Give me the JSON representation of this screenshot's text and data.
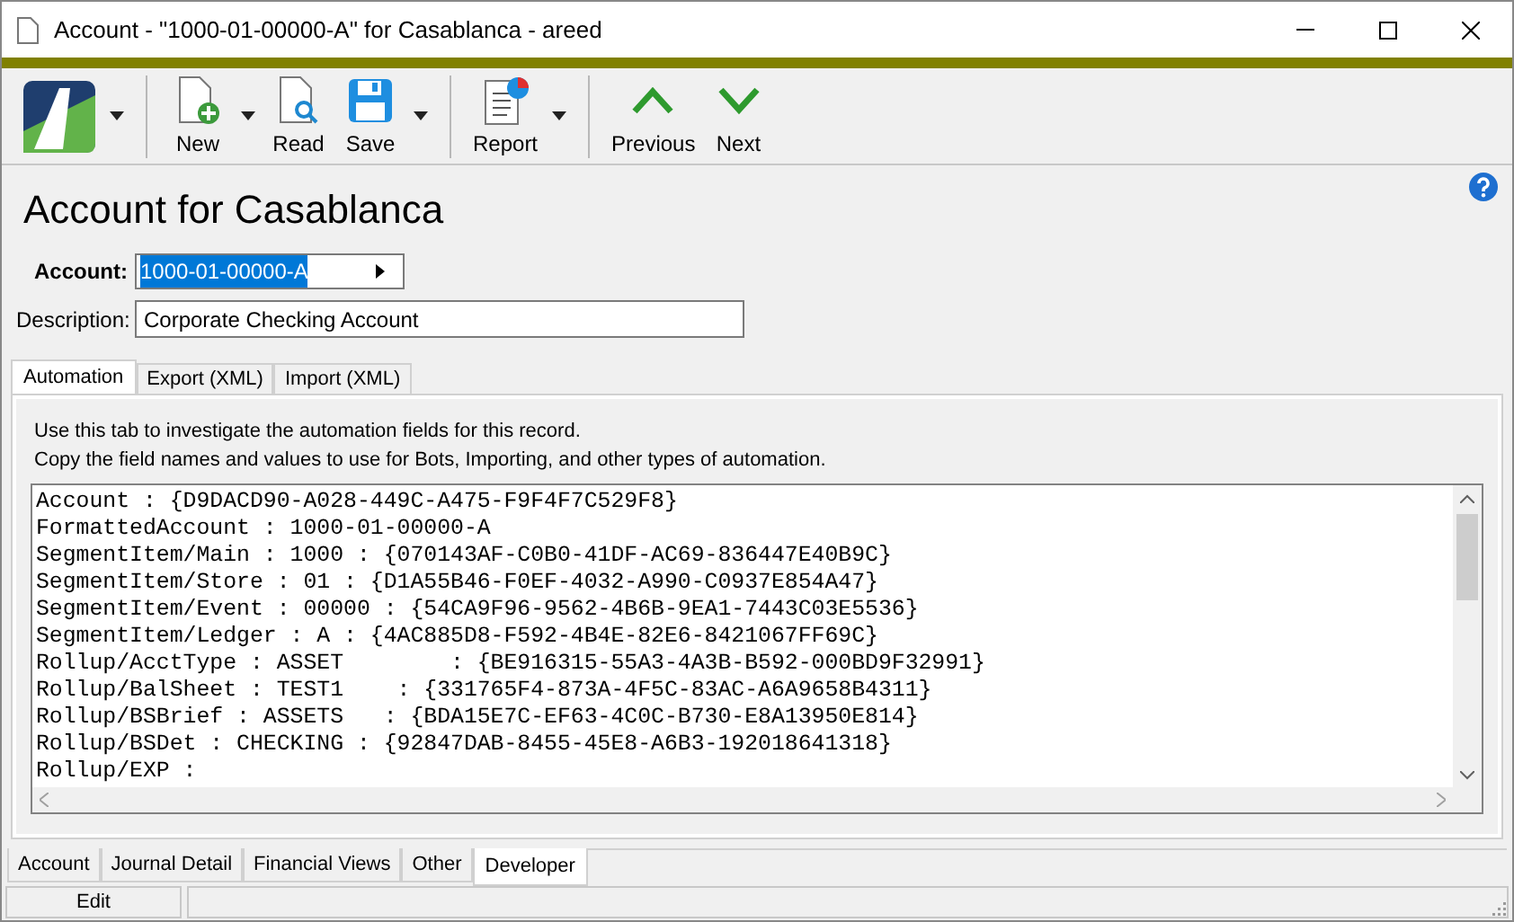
{
  "window": {
    "title": "Account - \"1000-01-00000-A\" for Casablanca - areed"
  },
  "toolbar": [
    {
      "kind": "logo",
      "dropdown": true
    },
    {
      "kind": "new",
      "label": "New",
      "dropdown": true
    },
    {
      "kind": "read",
      "label": "Read",
      "dropdown": false
    },
    {
      "kind": "save",
      "label": "Save",
      "dropdown": true
    },
    {
      "kind": "report",
      "label": "Report",
      "dropdown": true
    },
    {
      "kind": "previous",
      "label": "Previous",
      "dropdown": false
    },
    {
      "kind": "next",
      "label": "Next",
      "dropdown": false
    }
  ],
  "heading": "Account for Casablanca",
  "fields": {
    "account": {
      "label": "Account:",
      "value": "1000-01-00000-A"
    },
    "description": {
      "label": "Description:",
      "value": "Corporate Checking Account"
    }
  },
  "tabs": [
    {
      "label": "Automation",
      "selected": true
    },
    {
      "label": "Export (XML)",
      "selected": false
    },
    {
      "label": "Import (XML)",
      "selected": false
    }
  ],
  "intro": [
    "Use this tab to investigate the automation fields for this record.",
    "Copy the field names and values to use for Bots, Importing, and other types of automation."
  ],
  "automation_lines": [
    "Account : {D9DACD90-A028-449C-A475-F9F4F7C529F8}",
    "FormattedAccount : 1000-01-00000-A",
    "SegmentItem/Main : 1000 : {070143AF-C0B0-41DF-AC69-836447E40B9C}",
    "SegmentItem/Store : 01 : {D1A55B46-F0EF-4032-A990-C0937E854A47}",
    "SegmentItem/Event : 00000 : {54CA9F96-9562-4B6B-9EA1-7443C03E5536}",
    "SegmentItem/Ledger : A : {4AC885D8-F592-4B4E-82E6-8421067FF69C}",
    "Rollup/AcctType : ASSET        : {BE916315-55A3-4A3B-B592-000BD9F32991}",
    "Rollup/BalSheet : TEST1    : {331765F4-873A-4F5C-83AC-A6A9658B4311}",
    "Rollup/BSBrief : ASSETS   : {BDA15E7C-EF63-4C0C-B730-E8A13950E814}",
    "Rollup/BSDet : CHECKING : {92847DAB-8455-45E8-A6B3-192018641318}",
    "Rollup/EXP :"
  ],
  "bottom_tabs": [
    {
      "label": "Account",
      "selected": false
    },
    {
      "label": "Journal Detail",
      "selected": false
    },
    {
      "label": "Financial Views",
      "selected": false
    },
    {
      "label": "Other",
      "selected": false
    },
    {
      "label": "Developer",
      "selected": true
    }
  ],
  "status_bar": {
    "mode": "Edit"
  }
}
